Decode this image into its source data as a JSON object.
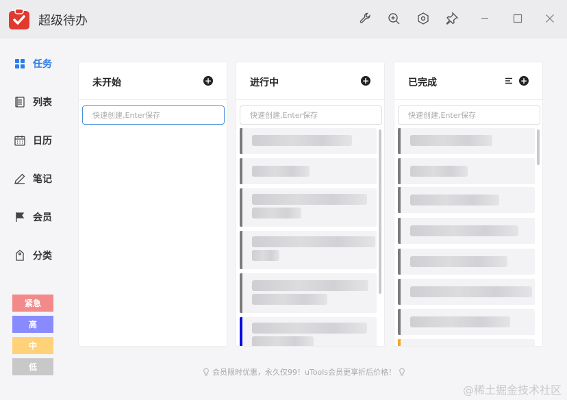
{
  "app": {
    "title": "超级待办"
  },
  "nav": [
    {
      "label": "任务",
      "icon": "grid-icon",
      "active": true
    },
    {
      "label": "列表",
      "icon": "list-icon",
      "active": false
    },
    {
      "label": "日历",
      "icon": "calendar-icon",
      "active": false
    },
    {
      "label": "笔记",
      "icon": "pencil-icon",
      "active": false
    },
    {
      "label": "会员",
      "icon": "flag-icon",
      "active": false
    },
    {
      "label": "分类",
      "icon": "tag-icon",
      "active": false
    }
  ],
  "priorities": [
    {
      "label": "紧急",
      "color": "#f28a8a"
    },
    {
      "label": "高",
      "color": "#8a8aff"
    },
    {
      "label": "中",
      "color": "#ffd27a"
    },
    {
      "label": "低",
      "color": "#c8c8c8"
    }
  ],
  "columns": [
    {
      "title": "未开始",
      "placeholder": "快速创建,Enter保存"
    },
    {
      "title": "进行中",
      "placeholder": "快速创建,Enter保存"
    },
    {
      "title": "已完成",
      "placeholder": "快速创建,Enter保存"
    }
  ],
  "footer": {
    "note": "会员限时优惠，永久仅99！uTools会员更享折后价格！"
  },
  "watermark": "@稀土掘金技术社区",
  "colors": {
    "accent": "#2b7de9",
    "logo_red": "#e03a2f"
  }
}
